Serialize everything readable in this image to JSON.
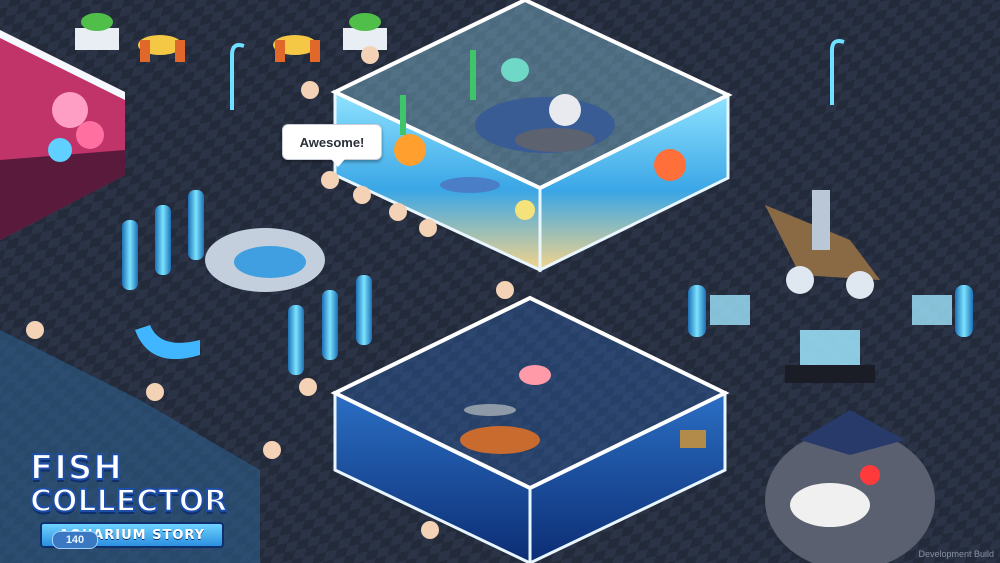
{
  "speech_bubble": {
    "text": "Awesome!"
  },
  "logo": {
    "line1": "FISH",
    "line2": "COLLECTOR",
    "tagline": "AQUARIUM STORY"
  },
  "counter": {
    "value": "140"
  },
  "build_label": "Development Build",
  "colors": {
    "floor": "#2a3142",
    "tank_water": "#3fa9e8",
    "deep_tank": "#1f4f9c",
    "accent": "#4fd0ff"
  }
}
